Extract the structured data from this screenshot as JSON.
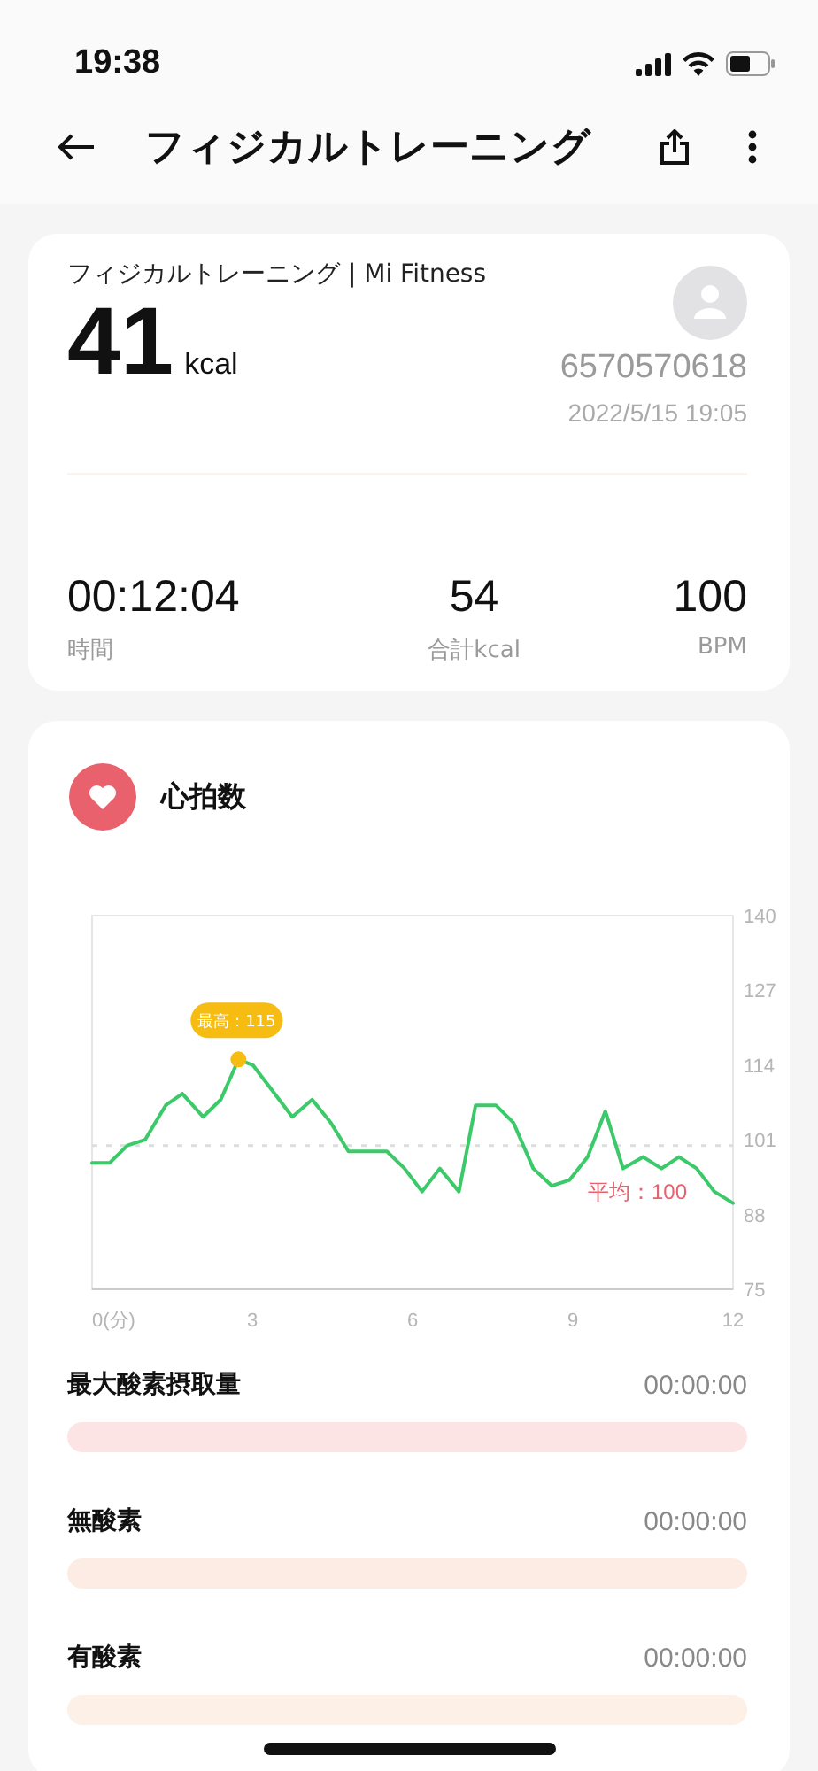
{
  "status_bar": {
    "time": "19:38"
  },
  "header": {
    "title": "フィジカルトレーニング"
  },
  "summary": {
    "source": "フィジカルトレーニング | Mi Fitness",
    "calories": "41",
    "calories_unit": "kcal",
    "user_id": "6570570618",
    "datetime": "2022/5/15 19:05",
    "stats": [
      {
        "value": "00:12:04",
        "label": "時間"
      },
      {
        "value": "54",
        "label": "合計kcal"
      },
      {
        "value": "100",
        "label": "BPM"
      }
    ]
  },
  "heart_rate": {
    "title": "心拍数",
    "chart_data": {
      "type": "line",
      "x": [
        0,
        0.33,
        0.66,
        0.99,
        1.38,
        1.69,
        2.08,
        2.41,
        2.74,
        3.01,
        3.75,
        4.12,
        4.47,
        4.8,
        5.52,
        5.85,
        6.18,
        6.51,
        6.87,
        7.18,
        7.56,
        7.89,
        8.26,
        8.61,
        8.94,
        9.28,
        9.61,
        9.94,
        10.32,
        10.66,
        10.99,
        11.32,
        11.65,
        12
      ],
      "series": [
        {
          "color": "#3cc96a",
          "values": [
            97,
            97,
            100,
            101,
            107,
            109,
            105,
            108,
            115,
            114,
            105,
            108,
            104,
            99,
            99,
            96,
            92,
            96,
            92,
            107,
            107,
            104,
            96,
            93,
            94,
            98,
            106,
            96,
            98,
            96,
            98,
            96,
            92,
            90
          ]
        }
      ],
      "xlim": [
        0,
        12
      ],
      "ylim": [
        75,
        140
      ],
      "xticks": [
        {
          "value": 0,
          "label": "0(分)"
        },
        3,
        6,
        9,
        12
      ],
      "yticks": [
        75,
        88,
        101,
        114,
        127,
        140
      ],
      "annotations": [
        {
          "text": "最高：115",
          "x": 2.74,
          "y": 115
        }
      ],
      "ref_lines": [
        {
          "axis": "y",
          "value": 100,
          "label": "平均：100"
        }
      ]
    }
  },
  "zones": [
    {
      "label": "最大酸素摂取量",
      "time": "00:00:00",
      "color": "#fde4e4"
    },
    {
      "label": "無酸素",
      "time": "00:00:00",
      "color": "#fdece4"
    },
    {
      "label": "有酸素",
      "time": "00:00:00",
      "color": "#fdf0e6"
    }
  ]
}
